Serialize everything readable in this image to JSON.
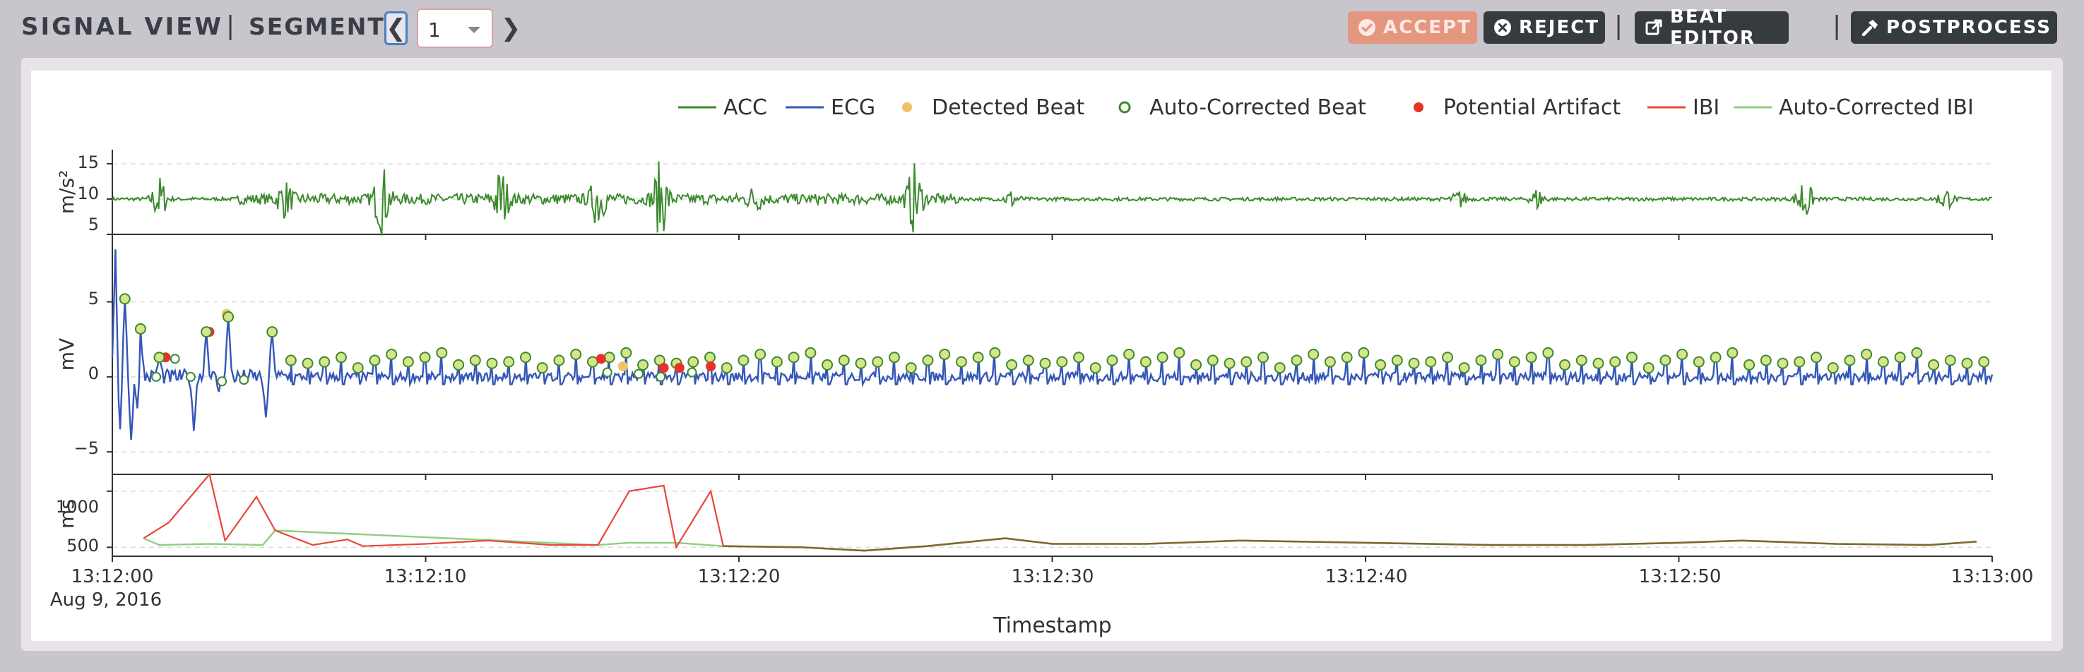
{
  "header": {
    "title": "SIGNAL VIEW",
    "separator": "|",
    "segment_label": "SEGMENT:",
    "segment_value": "1",
    "prev_glyph": "❮",
    "next_glyph": "❯"
  },
  "actions": {
    "accept": "ACCEPT",
    "reject": "REJECT",
    "beat_editor": "BEAT EDITOR",
    "postprocess": "POSTPROCESS"
  },
  "icons": {
    "accept": "check-circle-icon",
    "reject": "x-circle-icon",
    "beat_editor": "external-link-icon",
    "postprocess": "hammer-icon"
  },
  "colors": {
    "acc": "#3c8a2e",
    "ecg": "#3457b8",
    "detected": "#f2c26b",
    "auto_corrected_beat": "#3c8a2e",
    "artifact": "#e5332a",
    "ibi": "#e5483b",
    "auto_ibi": "#8fcf7f",
    "accept_bg": "#e4967f",
    "dark_btn": "#363b40"
  },
  "chart_data": {
    "type": "line",
    "legend": [
      "ACC",
      "ECG",
      "Detected Beat",
      "Auto-Corrected Beat",
      "Potential Artifact",
      "IBI",
      "Auto-Corrected IBI"
    ],
    "legend_position": "top-right",
    "xlabel": "Timestamp",
    "x_ticks": [
      "13:12:00",
      "13:12:10",
      "13:12:20",
      "13:12:30",
      "13:12:40",
      "13:12:50",
      "13:13:00"
    ],
    "x_date": "Aug 9, 2016",
    "xlim_seconds": [
      0,
      60
    ],
    "grid": true,
    "panels": [
      {
        "name": "ACC",
        "ylabel": "m/s²",
        "ylim": [
          5,
          17
        ],
        "yticks": [
          "15",
          "10",
          "5"
        ],
        "baseline": 10
      },
      {
        "name": "ECG",
        "ylabel": "mV",
        "ylim": [
          -6.5,
          9.5
        ],
        "yticks": [
          "5",
          "0",
          "−5"
        ]
      },
      {
        "name": "IBI",
        "ylabel": "ms",
        "ylim": [
          420,
          1150
        ],
        "yticks": [
          "1000",
          "500"
        ]
      }
    ],
    "acc_bursts": [
      {
        "t": 1.5,
        "amp": 3.2
      },
      {
        "t": 5.5,
        "amp": 2.2
      },
      {
        "t": 8.6,
        "amp": 4.5
      },
      {
        "t": 12.4,
        "amp": 4.0
      },
      {
        "t": 15.5,
        "amp": 3.5
      },
      {
        "t": 17.5,
        "amp": 5.0
      },
      {
        "t": 20.5,
        "amp": 1.5
      },
      {
        "t": 25.6,
        "amp": 4.5
      },
      {
        "t": 28.7,
        "amp": 1.2
      },
      {
        "t": 43.0,
        "amp": 1.2
      },
      {
        "t": 45.5,
        "amp": 1.5
      },
      {
        "t": 54.0,
        "amp": 3.5
      },
      {
        "t": 58.5,
        "amp": 1.6
      }
    ],
    "ecg_early_peaks": [
      {
        "t": 0.1,
        "y": 8.5
      },
      {
        "t": 0.4,
        "y": 5.2
      },
      {
        "t": 0.9,
        "y": 3.2
      },
      {
        "t": 1.5,
        "y": 1.3
      },
      {
        "t": 3.0,
        "y": 3.0
      },
      {
        "t": 3.7,
        "y": 4.0
      },
      {
        "t": 5.1,
        "y": 3.0
      }
    ],
    "ecg_early_troughs": [
      {
        "t": 0.25,
        "y": -3.5
      },
      {
        "t": 0.6,
        "y": -4.2
      },
      {
        "t": 0.85,
        "y": -5.5
      },
      {
        "t": 2.6,
        "y": -3.6
      },
      {
        "t": 3.4,
        "y": -1.0
      },
      {
        "t": 4.9,
        "y": -2.7
      }
    ],
    "beats_start_s": 5.7,
    "beat_interval_s": 0.535,
    "beat_amplitudes_mV": [
      1.1,
      0.9,
      1.0,
      1.3,
      0.6,
      1.1,
      1.5,
      1.0,
      1.3,
      1.6,
      0.8
    ],
    "artifacts": [
      {
        "t": 1.7,
        "y": 1.3
      },
      {
        "t": 3.1,
        "y": 3.0
      },
      {
        "t": 15.6,
        "y": 1.2
      },
      {
        "t": 17.6,
        "y": 0.6
      },
      {
        "t": 18.1,
        "y": 0.6
      },
      {
        "t": 19.1,
        "y": 0.7
      }
    ],
    "detected_only": [
      {
        "t": 3.65,
        "y": 4.2
      },
      {
        "t": 16.3,
        "y": 0.7
      }
    ],
    "auto_corrected_open": [
      {
        "t": 1.4,
        "y": 0.0
      },
      {
        "t": 2.0,
        "y": 1.2
      },
      {
        "t": 2.5,
        "y": 0.0
      },
      {
        "t": 3.5,
        "y": -0.3
      },
      {
        "t": 4.2,
        "y": -0.2
      },
      {
        "t": 15.8,
        "y": 0.3
      },
      {
        "t": 16.8,
        "y": 0.2
      },
      {
        "t": 17.5,
        "y": 0.0
      },
      {
        "t": 18.5,
        "y": 0.3
      }
    ],
    "ibi_points": [
      {
        "t": 1.0,
        "ms": 580
      },
      {
        "t": 1.8,
        "ms": 720
      },
      {
        "t": 3.1,
        "ms": 1150
      },
      {
        "t": 3.6,
        "ms": 560
      },
      {
        "t": 4.6,
        "ms": 950
      },
      {
        "t": 5.2,
        "ms": 650
      },
      {
        "t": 6.4,
        "ms": 520
      },
      {
        "t": 7.5,
        "ms": 570
      },
      {
        "t": 8.0,
        "ms": 510
      },
      {
        "t": 10.0,
        "ms": 530
      },
      {
        "t": 12.0,
        "ms": 560
      },
      {
        "t": 14.0,
        "ms": 520
      },
      {
        "t": 15.5,
        "ms": 520
      },
      {
        "t": 16.5,
        "ms": 1000
      },
      {
        "t": 17.6,
        "ms": 1050
      },
      {
        "t": 18.0,
        "ms": 500
      },
      {
        "t": 19.1,
        "ms": 1000
      },
      {
        "t": 19.5,
        "ms": 510
      },
      {
        "t": 22.0,
        "ms": 500
      },
      {
        "t": 24.0,
        "ms": 470
      },
      {
        "t": 26.0,
        "ms": 510
      },
      {
        "t": 28.5,
        "ms": 580
      },
      {
        "t": 30.0,
        "ms": 530
      },
      {
        "t": 33.0,
        "ms": 530
      },
      {
        "t": 36.0,
        "ms": 560
      },
      {
        "t": 40.0,
        "ms": 540
      },
      {
        "t": 44.0,
        "ms": 520
      },
      {
        "t": 47.0,
        "ms": 520
      },
      {
        "t": 50.0,
        "ms": 540
      },
      {
        "t": 52.0,
        "ms": 560
      },
      {
        "t": 55.0,
        "ms": 530
      },
      {
        "t": 58.0,
        "ms": 520
      },
      {
        "t": 59.5,
        "ms": 550
      }
    ],
    "auto_ibi_points": [
      {
        "t": 1.0,
        "ms": 580
      },
      {
        "t": 1.5,
        "ms": 520
      },
      {
        "t": 3.1,
        "ms": 530
      },
      {
        "t": 4.8,
        "ms": 520
      },
      {
        "t": 5.2,
        "ms": 650
      },
      {
        "t": 15.5,
        "ms": 520
      },
      {
        "t": 16.5,
        "ms": 540
      },
      {
        "t": 18.0,
        "ms": 540
      },
      {
        "t": 19.5,
        "ms": 510
      }
    ]
  }
}
